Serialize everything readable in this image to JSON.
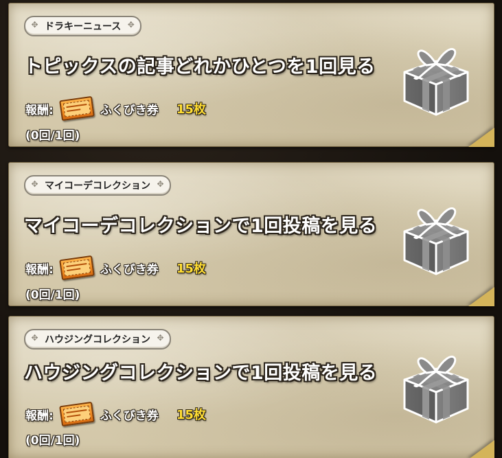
{
  "missions": [
    {
      "category": "ドラキーニュース",
      "title": "トピックスの記事どれかひとつを1回見る",
      "reward_label": "報酬:",
      "reward_icon": "lottery-ticket-icon",
      "reward_item": "ふくびき券",
      "reward_count": "15枚",
      "progress": "(0回/1回)",
      "progress_value": {
        "done": 0,
        "total": 1
      },
      "status_icon": "gift-box-icon",
      "status": "locked"
    },
    {
      "category": "マイコーデコレクション",
      "title": "マイコーデコレクションで1回投稿を見る",
      "reward_label": "報酬:",
      "reward_icon": "lottery-ticket-icon",
      "reward_item": "ふくびき券",
      "reward_count": "15枚",
      "progress": "(0回/1回)",
      "progress_value": {
        "done": 0,
        "total": 1
      },
      "status_icon": "gift-box-icon",
      "status": "locked"
    },
    {
      "category": "ハウジングコレクション",
      "title": "ハウジングコレクションで1回投稿を見る",
      "reward_label": "報酬:",
      "reward_icon": "lottery-ticket-icon",
      "reward_item": "ふくびき券",
      "reward_count": "15枚",
      "progress": "(0回/1回)",
      "progress_value": {
        "done": 0,
        "total": 1
      },
      "status_icon": "gift-box-icon",
      "status": "locked"
    }
  ],
  "colors": {
    "parchment": "#dcd2b8",
    "reward_count": "#ffdd33",
    "text_outline": "#2b241b",
    "gift_gray": "#7a7a7a"
  }
}
